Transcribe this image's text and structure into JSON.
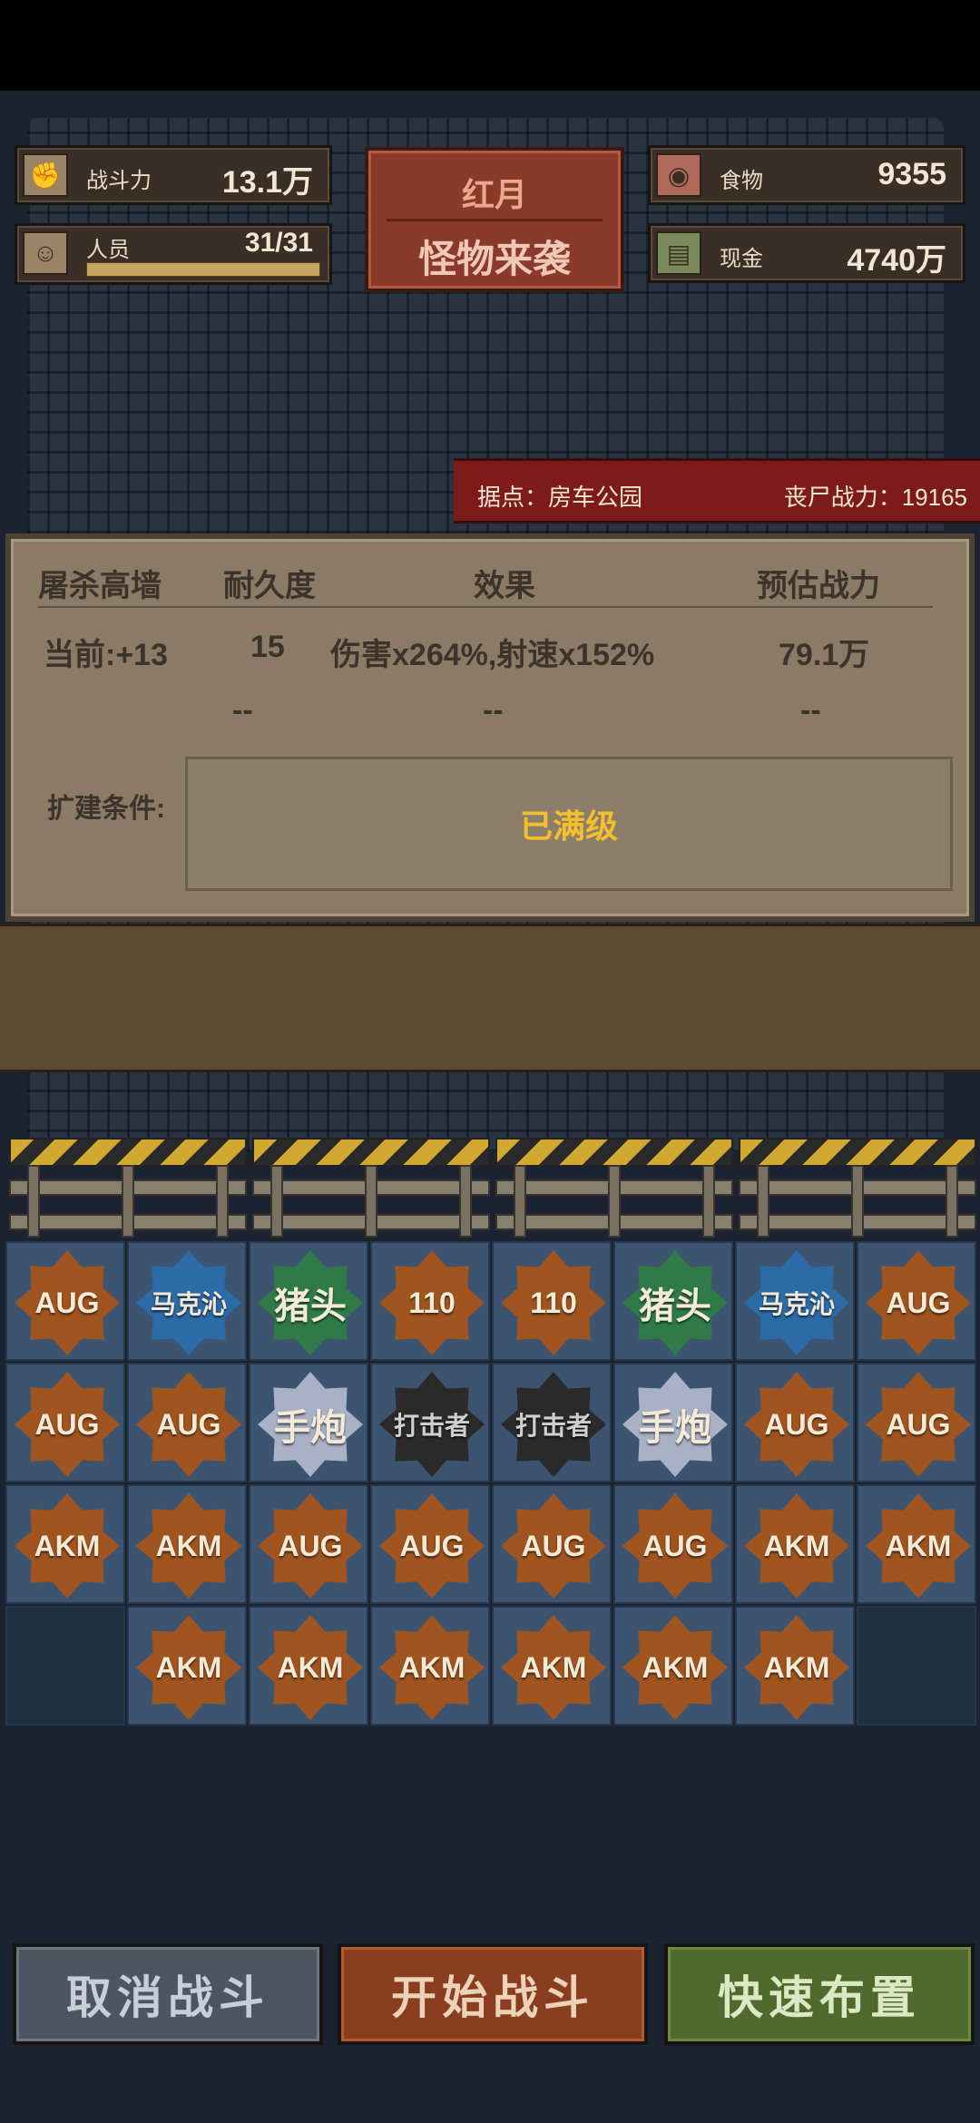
{
  "header": {
    "combat_label": "战斗力",
    "combat_value": "13.1万",
    "people_label": "人员",
    "people_value": "31/31",
    "people_fill": 1.0,
    "food_label": "食物",
    "food_value": "9355",
    "cash_label": "现金",
    "cash_value": "4740万"
  },
  "event": {
    "line1": "红月",
    "line2": "怪物来袭"
  },
  "base": {
    "name": "据点：房车公园",
    "zombie_power": "丧尸战力：19165"
  },
  "panel": {
    "col1": "屠杀高墙",
    "col2": "耐久度",
    "col3": "效果",
    "col4": "预估战力",
    "current_level": "当前:+13",
    "durability": "15",
    "effect": "伤害x264%,射速x152%",
    "estimated_power": "79.1万",
    "next_dash1": "--",
    "next_dash2": "--",
    "next_dash3": "--",
    "expand_label": "扩建条件:",
    "expand_status": "已满级"
  },
  "grid": {
    "rows": [
      [
        {
          "label": "AUG",
          "color": "orange"
        },
        {
          "label": "马克沁",
          "color": "blue"
        },
        {
          "label": "猪头",
          "color": "green"
        },
        {
          "label": "110",
          "color": "orange"
        },
        {
          "label": "110",
          "color": "orange"
        },
        {
          "label": "猪头",
          "color": "green"
        },
        {
          "label": "马克沁",
          "color": "blue"
        },
        {
          "label": "AUG",
          "color": "orange"
        }
      ],
      [
        {
          "label": "AUG",
          "color": "orange"
        },
        {
          "label": "AUG",
          "color": "orange"
        },
        {
          "label": "手炮",
          "color": "silver"
        },
        {
          "label": "打击者",
          "color": "black"
        },
        {
          "label": "打击者",
          "color": "black"
        },
        {
          "label": "手炮",
          "color": "silver"
        },
        {
          "label": "AUG",
          "color": "orange"
        },
        {
          "label": "AUG",
          "color": "orange"
        }
      ],
      [
        {
          "label": "AKM",
          "color": "orange"
        },
        {
          "label": "AKM",
          "color": "orange"
        },
        {
          "label": "AUG",
          "color": "orange"
        },
        {
          "label": "AUG",
          "color": "orange"
        },
        {
          "label": "AUG",
          "color": "orange"
        },
        {
          "label": "AUG",
          "color": "orange"
        },
        {
          "label": "AKM",
          "color": "orange"
        },
        {
          "label": "AKM",
          "color": "orange"
        }
      ],
      [
        null,
        {
          "label": "AKM",
          "color": "orange"
        },
        {
          "label": "AKM",
          "color": "orange"
        },
        {
          "label": "AKM",
          "color": "orange"
        },
        {
          "label": "AKM",
          "color": "orange"
        },
        {
          "label": "AKM",
          "color": "orange"
        },
        {
          "label": "AKM",
          "color": "orange"
        },
        null
      ]
    ]
  },
  "buttons": {
    "cancel": "取消战斗",
    "start": "开始战斗",
    "quick": "快速布置"
  },
  "icons": {
    "combat": "fist-icon",
    "people": "person-icon",
    "food": "meat-icon",
    "cash": "cash-icon"
  }
}
